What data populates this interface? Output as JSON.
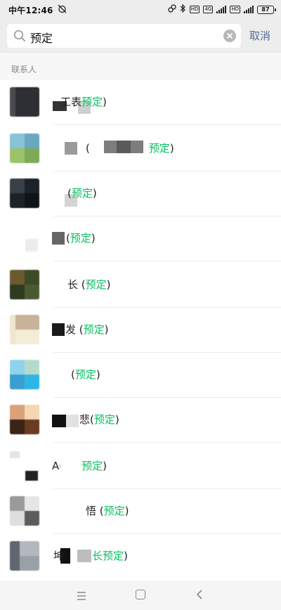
{
  "status_bar": {
    "time": "中午12:46",
    "battery": "87",
    "network_tag": "4G",
    "hd_tag": "HD"
  },
  "search": {
    "query": "预定",
    "cancel_label": "取消"
  },
  "section": {
    "title": "联系人"
  },
  "contacts": [
    {
      "name_prefix": "工表",
      "keyword": "预定",
      "name_suffix": ")"
    },
    {
      "name_prefix": "(",
      "keyword": "预定",
      "name_suffix": ")"
    },
    {
      "name_prefix": "(",
      "keyword": "预定",
      "name_suffix": ")"
    },
    {
      "name_prefix": "(",
      "keyword": "预定",
      "name_suffix": ")"
    },
    {
      "name_prefix": "长 (",
      "keyword": "预定",
      "name_suffix": ")"
    },
    {
      "name_prefix": "发 (",
      "keyword": "预定",
      "name_suffix": ")"
    },
    {
      "name_prefix": "(",
      "keyword": "预定",
      "name_suffix": ")"
    },
    {
      "name_prefix": "悲(",
      "keyword": "预定",
      "name_suffix": ")"
    },
    {
      "name_prefix": "A(",
      "keyword": "预定",
      "name_suffix": ")"
    },
    {
      "name_prefix": "悟 (",
      "keyword": "预定",
      "name_suffix": ")"
    },
    {
      "name_prefix": "坤",
      "keyword": "长预定",
      "name_suffix": ")"
    }
  ],
  "colors": {
    "keyword": "#07c160",
    "cancel": "#576b95",
    "header_bg": "#ededed"
  },
  "icons": {
    "search": "search-icon",
    "clear": "clear-icon",
    "bluetooth": "bluetooth-icon",
    "alarm_off": "alarm-off-icon",
    "nav_menu": "menu-icon",
    "nav_home": "home-icon",
    "nav_back": "back-icon"
  }
}
